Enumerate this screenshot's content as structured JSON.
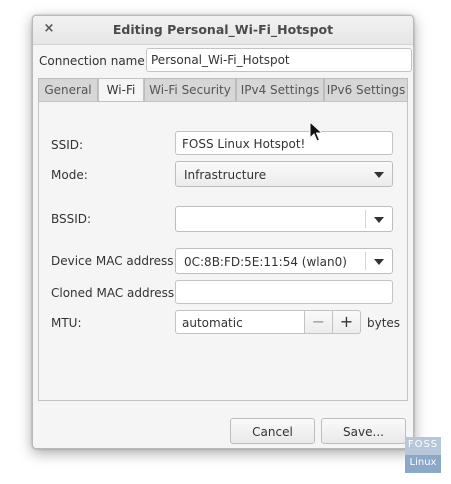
{
  "window": {
    "title": "Editing Personal_Wi-Fi_Hotspot",
    "close_glyph": "×"
  },
  "connection": {
    "label": "Connection name:",
    "value": "Personal_Wi-Fi_Hotspot"
  },
  "tabs": [
    {
      "label": "General"
    },
    {
      "label": "Wi-Fi",
      "active": true
    },
    {
      "label": "Wi-Fi Security"
    },
    {
      "label": "IPv4 Settings"
    },
    {
      "label": "IPv6 Settings"
    }
  ],
  "form": {
    "ssid": {
      "label": "SSID:",
      "value": "FOSS Linux Hotspot!"
    },
    "mode": {
      "label": "Mode:",
      "value": "Infrastructure"
    },
    "bssid": {
      "label": "BSSID:",
      "value": ""
    },
    "device_mac": {
      "label": "Device MAC address:",
      "value": "0C:8B:FD:5E:11:54 (wlan0)"
    },
    "cloned_mac": {
      "label": "Cloned MAC address:",
      "value": ""
    },
    "mtu": {
      "label": "MTU:",
      "value": "automatic",
      "minus": "−",
      "plus": "+",
      "unit": "bytes"
    }
  },
  "buttons": {
    "cancel": "Cancel",
    "save": "Save..."
  },
  "watermark": {
    "top": "FOSS",
    "bottom": "Linux"
  },
  "icons": {
    "close": "close-icon",
    "dropdown": "chevron-down-icon",
    "pointer": "mouse-pointer-icon"
  },
  "colors": {
    "window_bg": "#f5f5f5",
    "tab_inactive": "#d7d7d7",
    "border": "#c3c3c3"
  }
}
